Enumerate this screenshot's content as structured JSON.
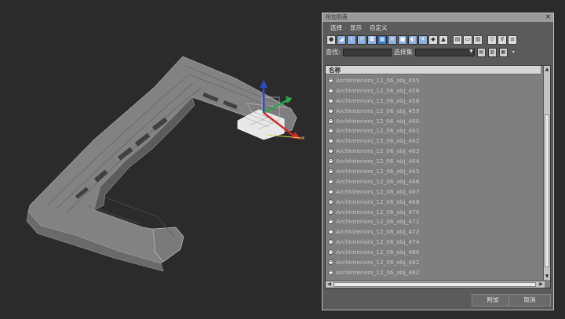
{
  "dialog": {
    "title": "附加到表",
    "close_glyph": "×",
    "menu": [
      "选择",
      "显示",
      "自定义"
    ],
    "find_label": "查找:",
    "find_value": "",
    "selection_set_label": "选择集",
    "selection_set_value": "",
    "list_header": "名称",
    "items": [
      "ArchInteriors_12_06_obj_455",
      "ArchInteriors_12_06_obj_456",
      "ArchInteriors_12_06_obj_458",
      "ArchInteriors_12_06_obj_459",
      "ArchInteriors_12_06_obj_460",
      "ArchInteriors_12_06_obj_461",
      "ArchInteriors_12_06_obj_462",
      "ArchInteriors_12_06_obj_463",
      "ArchInteriors_12_06_obj_464",
      "ArchInteriors_12_06_obj_465",
      "ArchInteriors_12_06_obj_466",
      "ArchInteriors_12_06_obj_467",
      "ArchInteriors_12_06_obj_468",
      "ArchInteriors_12_06_obj_470",
      "ArchInteriors_12_06_obj_471",
      "ArchInteriors_12_06_obj_472",
      "ArchInteriors_12_06_obj_474",
      "ArchInteriors_12_06_obj_480",
      "ArchInteriors_12_06_obj_481",
      "ArchInteriors_12_06_obj_482"
    ],
    "ok_label": "附加",
    "cancel_label": "取消"
  },
  "viewport": {
    "gizmo_axes": [
      "y",
      "x"
    ]
  },
  "colors": {
    "viewport_bg": "#2b2b2b",
    "dialog_bg": "#5b5b5b",
    "list_bg": "#7f7f80",
    "axis_z": "#2a4cc8",
    "axis_y": "#2aa84a",
    "axis_x": "#d02a2a"
  }
}
